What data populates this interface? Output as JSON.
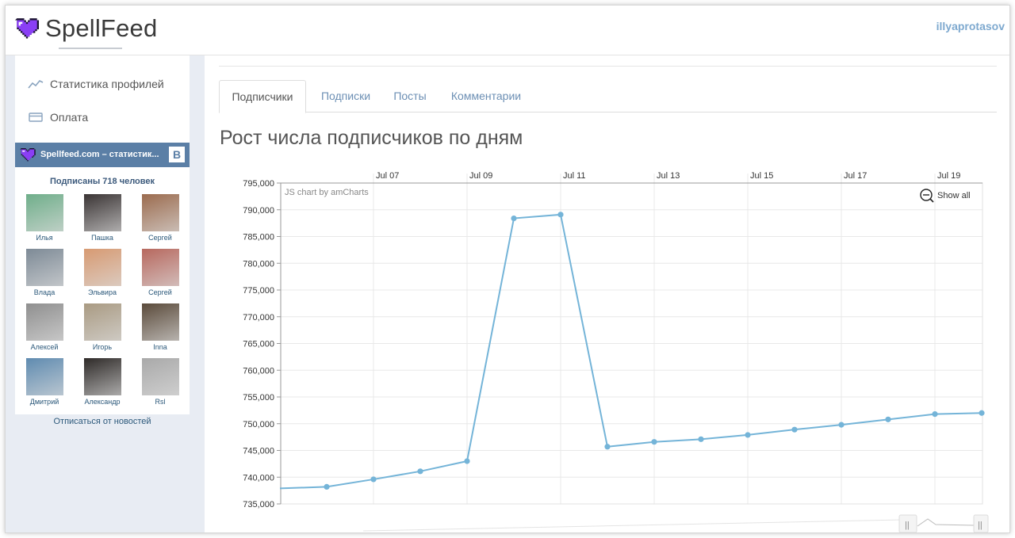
{
  "app": {
    "name": "SpellFeed",
    "username": "illyaprotasov",
    "brand_color": "#8a3ff5",
    "link_color": "#7ea9cf"
  },
  "sidebar": {
    "menu": [
      {
        "label": "Статистика профилей",
        "icon": "trend-line-icon"
      },
      {
        "label": "Оплата",
        "icon": "credit-card-icon"
      }
    ],
    "vk_widget": {
      "title": "Spellfeed.com – статистик...",
      "vk_badge": "B",
      "header_color": "#5b7fa6",
      "subscribed": "Подписаны 718 человек",
      "friends": [
        {
          "name": "Илья",
          "color": "#6fae8a"
        },
        {
          "name": "Пашка",
          "color": "#3a3434"
        },
        {
          "name": "Сергей",
          "color": "#9b6b4e"
        },
        {
          "name": "Влада",
          "color": "#7d8a96"
        },
        {
          "name": "Эльвира",
          "color": "#d79a72"
        },
        {
          "name": "Сергей",
          "color": "#b7685e"
        },
        {
          "name": "Алексей",
          "color": "#8f8f8f"
        },
        {
          "name": "Игорь",
          "color": "#a99a82"
        },
        {
          "name": "Inna",
          "color": "#5a4a3a"
        },
        {
          "name": "Дмитрий",
          "color": "#5f8bb0"
        },
        {
          "name": "Александр",
          "color": "#2e2a28"
        },
        {
          "name": "Rsl",
          "color": "#a9a9a9"
        }
      ],
      "unsubscribe": "Отписаться от новостей"
    }
  },
  "main": {
    "tabs": [
      {
        "label": "Подписчики",
        "active": true
      },
      {
        "label": "Подписки",
        "active": false
      },
      {
        "label": "Посты",
        "active": false
      },
      {
        "label": "Комментарии",
        "active": false
      }
    ],
    "chart_title": "Рост числа подписчиков по дням",
    "credit": "JS chart by amCharts",
    "show_all": "Show all"
  },
  "chart_data": {
    "type": "line",
    "title": "Рост числа подписчиков по дням",
    "xlabel": "",
    "ylabel": "",
    "x": [
      "Jul 05",
      "Jul 06",
      "Jul 07",
      "Jul 08",
      "Jul 09",
      "Jul 10",
      "Jul 11",
      "Jul 12",
      "Jul 13",
      "Jul 14",
      "Jul 15",
      "Jul 16",
      "Jul 17",
      "Jul 18",
      "Jul 19",
      "Jul 20"
    ],
    "values": [
      737900,
      738200,
      739600,
      741100,
      743000,
      788400,
      789100,
      745700,
      746600,
      747100,
      747900,
      748900,
      749800,
      750800,
      751800,
      752000
    ],
    "x_tick_labels": [
      "Jul 07",
      "Jul 09",
      "Jul 11",
      "Jul 13",
      "Jul 15",
      "Jul 17",
      "Jul 19"
    ],
    "y_tick_labels": [
      "795,000",
      "790,000",
      "785,000",
      "780,000",
      "775,000",
      "770,000",
      "765,000",
      "760,000",
      "755,000",
      "750,000",
      "745,000",
      "740,000",
      "735,000"
    ],
    "ylim": [
      735000,
      795000
    ],
    "grid": true,
    "line_color": "#74b4d8"
  }
}
